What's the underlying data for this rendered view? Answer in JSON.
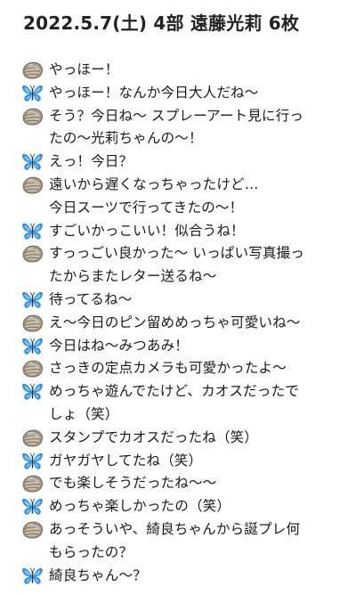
{
  "title": "2022.5.7(土) 4部 遠藤光莉 6枚",
  "messages": [
    {
      "icon": "oyster-icon",
      "text": "やっほー！"
    },
    {
      "icon": "butterfly-icon",
      "text": "やっほー！なんか今日大人だね〜"
    },
    {
      "icon": "oyster-icon",
      "text": "そう？今日ね〜 スプレーアート見に行っ\nたの〜光莉ちゃんの〜！"
    },
    {
      "icon": "butterfly-icon",
      "text": "えっ！今日？"
    },
    {
      "icon": "oyster-icon",
      "text": "遠いから遅くなっちゃったけど…\n今日スーツで行ってきたの〜！"
    },
    {
      "icon": "butterfly-icon",
      "text": "すごいかっこいい！似合うね！"
    },
    {
      "icon": "oyster-icon",
      "text": "すっっごい良かった〜 いっぱい写真撮っ\nたからまたレター送るね〜"
    },
    {
      "icon": "butterfly-icon",
      "text": "待ってるね〜"
    },
    {
      "icon": "oyster-icon",
      "text": "え〜今日のピン留めめっちゃ可愛いね〜"
    },
    {
      "icon": "butterfly-icon",
      "text": "今日はね〜みつあみ！"
    },
    {
      "icon": "oyster-icon",
      "text": "さっきの定点カメラも可愛かったよ〜"
    },
    {
      "icon": "butterfly-icon",
      "text": "めっちゃ遊んでたけど、カオスだったで\nしょ（笑）"
    },
    {
      "icon": "oyster-icon",
      "text": "スタンプでカオスだったね（笑）"
    },
    {
      "icon": "butterfly-icon",
      "text": "ガヤガヤしてたね（笑）"
    },
    {
      "icon": "oyster-icon",
      "text": "でも楽しそうだったね〜〜"
    },
    {
      "icon": "butterfly-icon",
      "text": "めっちゃ楽しかったの（笑）"
    },
    {
      "icon": "oyster-icon",
      "text": "あっそういや、綺良ちゃんから誕プレ何\nもらったの？"
    },
    {
      "icon": "butterfly-icon",
      "text": "綺良ちゃん〜？"
    }
  ],
  "colors": {
    "butterfly": "#2e8fd8",
    "butterfly_light": "#7cc4f5",
    "oyster": "#a79a85",
    "oyster_dark": "#6e6456"
  }
}
